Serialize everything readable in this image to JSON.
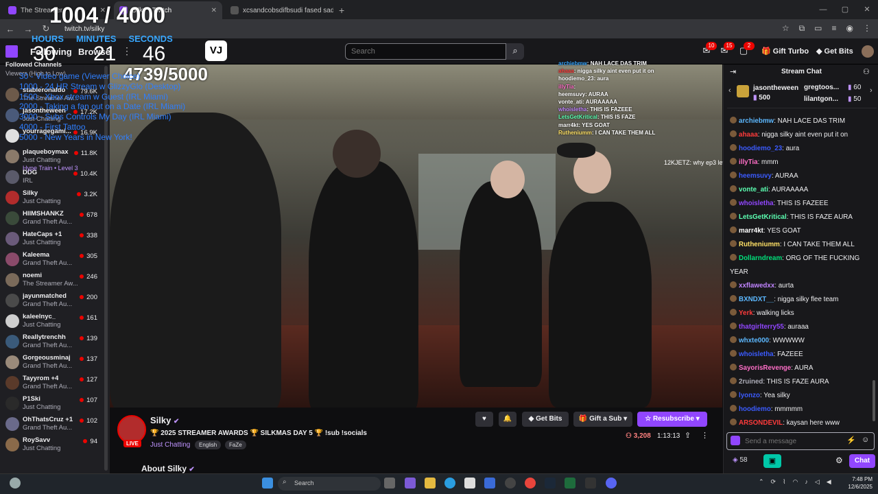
{
  "browser": {
    "tabs": [
      {
        "title": "The Streamer",
        "active": false
      },
      {
        "title": "Silky - Twitch",
        "active": true
      },
      {
        "title": "xcsandcobsdifbsudi fased sad...",
        "active": false
      }
    ],
    "url": "twitch.tv/silky",
    "new_tab": "+"
  },
  "topnav": {
    "following": "Following",
    "browse": "Browse",
    "vj_badge": "VJ",
    "search_placeholder": "Search",
    "notif_badges": [
      "10",
      "15",
      "2"
    ],
    "gift_turbo": "Gift Turbo",
    "get_bits": "Get Bits"
  },
  "overlay": {
    "subathon_count": "1004 / 4000",
    "labels": [
      "HOURS",
      "MINUTES",
      "SECONDS"
    ],
    "hours": "30",
    "minutes": "21",
    "seconds": "46",
    "goal": "4739/5000",
    "goals": [
      "30 - Video game (Viewer Choice)",
      "1000 - 24 HR Stream w GlizzyGlo (Desktop)",
      "1500 - Xbox stream w Guest (IRL Miami)",
      "2000 - Taking a fan out on a Date (IRL Miami)",
      "3000 - Subs Controls My Day (IRL Miami)",
      "4000 - First Tattoo",
      "5000 - New Years in New York!"
    ],
    "chat": [
      {
        "user": "archiebmw",
        "msg": "NAH LACE DAS TRIM",
        "color": "#38a7ff"
      },
      {
        "user": "ahaaa",
        "msg": "nigga silky aint even put it on",
        "color": "#ff3b3b"
      },
      {
        "user": "hoodiemo_23",
        "msg": "aura",
        "color": "#ffffff"
      },
      {
        "user": "illyTia",
        "msg": "",
        "color": "#ff6ec7"
      },
      {
        "user": "heemsuvy",
        "msg": "AURAA",
        "color": "#ffffff"
      },
      {
        "user": "vonte_ati",
        "msg": "AURAAAAA",
        "color": "#ffffff"
      },
      {
        "user": "whoisletha",
        "msg": "THIS IS FAZEEE",
        "color": "#c084ff"
      },
      {
        "user": "LetsGetKritical",
        "msg": "THIS IS FAZE",
        "color": "#5cffb2"
      },
      {
        "user": "marr4kt",
        "msg": "YES GOAT",
        "color": "#ffffff"
      },
      {
        "user": "Rutheniumm",
        "msg": "I CAN TAKE THEM ALL",
        "color": "#ffe066"
      }
    ],
    "jetz_line": "12KJETZ: why ep3 left"
  },
  "sidebar": {
    "title": "Followed Channels",
    "sort": "Viewers (High to Low)",
    "channels": [
      {
        "name": "stableronaldo",
        "game": "The Streamer Aw...",
        "viewers": "79.6K",
        "color": "#6d5a4a"
      },
      {
        "name": "jasontheween",
        "game": "Just Chatting",
        "viewers": "17.2K",
        "color": "#4a5a7a"
      },
      {
        "name": "yourragegami...",
        "game": "",
        "viewers": "16.9K",
        "color": "#e0e0e0"
      },
      {
        "name": "plaqueboymax",
        "game": "Just Chatting",
        "viewers": "11.8K",
        "color": "#8a7a6a"
      },
      {
        "name": "DDG",
        "game": "IRL",
        "viewers": "10.4K",
        "color": "#5a5a6a"
      },
      {
        "name": "Silky",
        "game": "Just Chatting",
        "viewers": "3.2K",
        "color": "#b22c2c"
      },
      {
        "name": "HIIMSHANKZ",
        "game": "Grand Theft Au...",
        "viewers": "678",
        "color": "#3a4a3a"
      },
      {
        "name": "HateCaps +1",
        "game": "Just Chatting",
        "viewers": "338",
        "color": "#6a5a7a"
      },
      {
        "name": "Kaleema",
        "game": "Grand Theft Au...",
        "viewers": "305",
        "color": "#8a4a6a"
      },
      {
        "name": "noemi",
        "game": "The Streamer Aw...",
        "viewers": "246",
        "color": "#7a6a5a"
      },
      {
        "name": "jayunmatched",
        "game": "Grand Theft Au...",
        "viewers": "200",
        "color": "#4a4a4a"
      },
      {
        "name": "kaleelnyc_",
        "game": "Just Chatting",
        "viewers": "161",
        "color": "#cfcfcf"
      },
      {
        "name": "Reallytrenchh",
        "game": "Grand Theft Au...",
        "viewers": "139",
        "color": "#3a5a7a"
      },
      {
        "name": "Gorgeousminaj",
        "game": "Grand Theft Au...",
        "viewers": "137",
        "color": "#9a8a7a"
      },
      {
        "name": "Tayyrom +4",
        "game": "Grand Theft Au...",
        "viewers": "127",
        "color": "#5a3a2a"
      },
      {
        "name": "P1Ski",
        "game": "Just Chatting",
        "viewers": "107",
        "color": "#2a2a2a"
      },
      {
        "name": "OhThatsCruz +1",
        "game": "Grand Theft Au...",
        "viewers": "102",
        "color": "#6a6a8a"
      },
      {
        "name": "RoySavv",
        "game": "Just Chatting",
        "viewers": "94",
        "color": "#8a6a4a"
      }
    ],
    "hype_train": "Hype Train • Level 3"
  },
  "stream": {
    "name": "Silky",
    "title": "🏆 2025 STREAMER AWARDS 🏆 SILKMAS DAY 5 🏆 !sub !socials",
    "category": "Just Chatting",
    "tags": [
      "English",
      "FaZe"
    ],
    "live": "LIVE",
    "get_bits": "Get Bits",
    "gift_sub": "Gift a Sub",
    "resubscribe": "Resubscribe",
    "viewers": "3,208",
    "uptime": "1:13:13",
    "about": "About Silky"
  },
  "chat": {
    "title": "Stream Chat",
    "leaderboard": [
      {
        "name": "jasontheween",
        "value": "500"
      },
      {
        "name": "gregtoos...",
        "value": "60"
      },
      {
        "name": "lilantgon...",
        "value": "50"
      }
    ],
    "messages": [
      {
        "user": "archiebmw",
        "msg": "NAH LACE DAS TRIM",
        "color": "#5cb8ff"
      },
      {
        "user": "ahaaa",
        "msg": "nigga silky aint even put it on",
        "color": "#ff3b3b"
      },
      {
        "user": "hoodiemo_23",
        "msg": "aura",
        "color": "#3b5bff"
      },
      {
        "user": "illyTia",
        "msg": "mmm",
        "color": "#ff6ec7"
      },
      {
        "user": "heemsuvy",
        "msg": "AURAA",
        "color": "#3b5bff"
      },
      {
        "user": "vonte_ati",
        "msg": "AURAAAAA",
        "color": "#5cffb2"
      },
      {
        "user": "whoisletha",
        "msg": "THIS IS FAZEEE",
        "color": "#9146ff"
      },
      {
        "user": "LetsGetKritical",
        "msg": "THIS IS FAZE AURA",
        "color": "#5cffb2"
      },
      {
        "user": "marr4kt",
        "msg": "YES GOAT",
        "color": "#ffffff"
      },
      {
        "user": "Rutheniumm",
        "msg": "I CAN TAKE THEM ALL",
        "color": "#ffe066"
      },
      {
        "user": "Dollarndream",
        "msg": "ORG OF THE FUCKING",
        "color": "#00e07a"
      },
      {
        "user": "",
        "msg": "YEAR",
        "color": "#efeff1"
      },
      {
        "user": "xxflawedxx",
        "msg": "aurta",
        "color": "#c084ff"
      },
      {
        "user": "BXNDXT__",
        "msg": "nigga silky flee team",
        "color": "#5cb8ff"
      },
      {
        "user": "Yerk",
        "msg": "walking licks",
        "color": "#ff3b3b"
      },
      {
        "user": "thatgirlterry55",
        "msg": "auraaa",
        "color": "#9146ff"
      },
      {
        "user": "whxte000",
        "msg": "WWWWW",
        "color": "#5cb8ff"
      },
      {
        "user": "whoisletha",
        "msg": "FAZEEE",
        "color": "#3b5bff"
      },
      {
        "user": "SayorisRevenge",
        "msg": "AURA",
        "color": "#ff6ec7"
      },
      {
        "user": "2ruined",
        "msg": "THIS IS FAZE AURA",
        "color": "#adadb8"
      },
      {
        "user": "lyonzo",
        "msg": "Yea silky",
        "color": "#3b5bff"
      },
      {
        "user": "hoodiemo",
        "msg": "mmmmm",
        "color": "#3b5bff"
      },
      {
        "user": "ARSONDEVIL",
        "msg": "kaysan here www",
        "color": "#ff3b3b"
      }
    ],
    "input_placeholder": "Send a message",
    "points": "58",
    "chat_button": "Chat"
  },
  "taskbar": {
    "search": "Search",
    "time": "7:48 PM",
    "date": "12/6/2025"
  }
}
